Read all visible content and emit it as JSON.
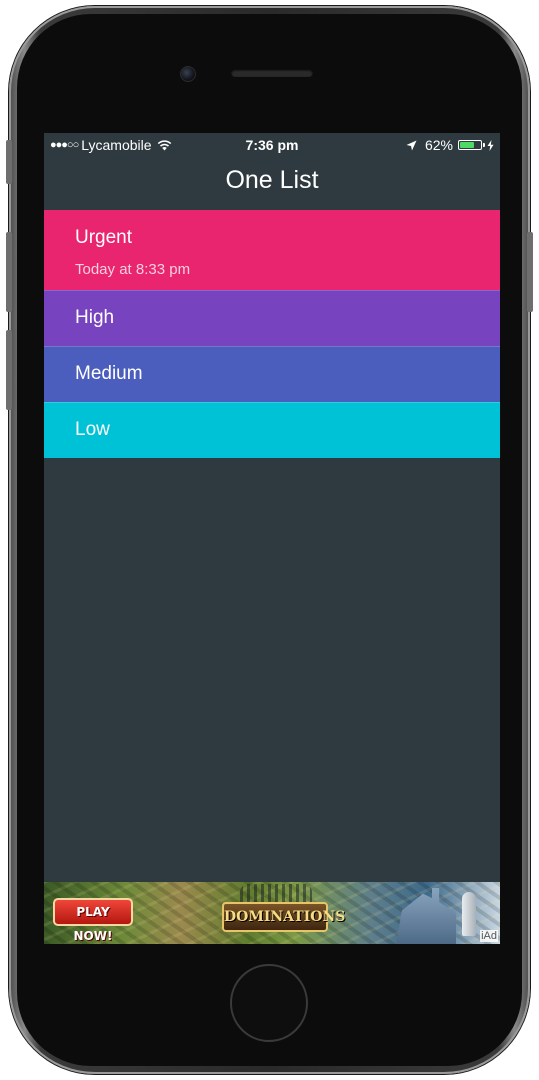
{
  "status_bar": {
    "signal": "●●●○○",
    "carrier": "Lycamobile",
    "time": "7:36 pm",
    "battery_percent_text": "62%",
    "battery_level": 0.62,
    "icons": [
      "wifi-icon",
      "location-arrow-icon",
      "battery-icon",
      "charging-bolt-icon"
    ]
  },
  "nav": {
    "title": "One List"
  },
  "list": {
    "items": [
      {
        "label": "Urgent",
        "subtitle": "Today at 8:33 pm",
        "color": "#e8256e"
      },
      {
        "label": "High",
        "color": "#7743bf"
      },
      {
        "label": "Medium",
        "color": "#4b5dbd"
      },
      {
        "label": "Low",
        "color": "#00c2d6"
      }
    ]
  },
  "ad": {
    "button_label": "PLAY NOW!",
    "logo_text": "DOMINATIONS",
    "badge": "iAd"
  },
  "colors": {
    "screen_background": "#2f3a40",
    "device_body": "#0c0c0d"
  }
}
